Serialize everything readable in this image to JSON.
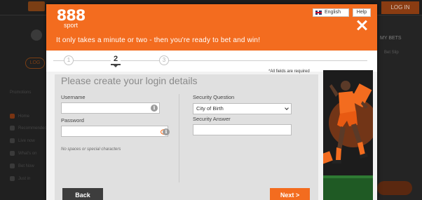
{
  "background": {
    "topbar_text": "888",
    "login_button": "LOG IN",
    "sidebar_login": "LOG",
    "sidebar_items": [
      "Promotions",
      "Home",
      "Recommended",
      "Live now",
      "What's on",
      "Bet Now",
      "Just in"
    ],
    "right_panel": {
      "my_bets": "MY BETS",
      "sub_text": "Bet Slip"
    }
  },
  "modal": {
    "logo": {
      "number": "888",
      "sub": "sport"
    },
    "tagline": "It only takes a minute or two - then you're ready to bet and win!",
    "language_button": "English",
    "help_button": "Help",
    "steps": [
      "1",
      "2",
      "3"
    ],
    "current_step": 2,
    "required_note": "*All fields are required",
    "form_title": "Please create your login details",
    "username": {
      "label": "Username",
      "value": "",
      "placeholder": ""
    },
    "password": {
      "label": "Password",
      "value": "",
      "placeholder": ""
    },
    "password_hint": "No spaces or special characters",
    "security_question": {
      "label": "Security Question",
      "selected": "City of Birth"
    },
    "security_answer": {
      "label": "Security Answer",
      "value": ""
    },
    "back_button": "Back",
    "next_button": "Next >",
    "info_glyph": "i"
  },
  "colors": {
    "brand_orange": "#f36c1f",
    "dark_button": "#3d3d3d",
    "panel_grey": "#e0e0e0"
  }
}
